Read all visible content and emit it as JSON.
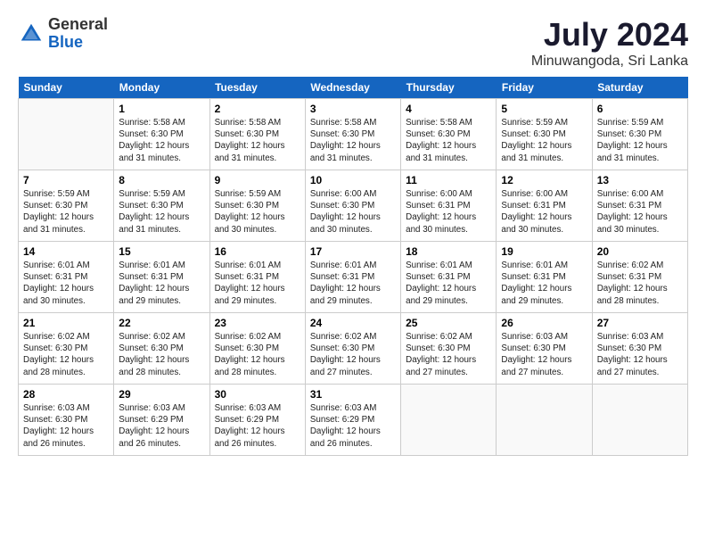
{
  "header": {
    "logo": {
      "general": "General",
      "blue": "Blue"
    },
    "title": "July 2024",
    "location": "Minuwangoda, Sri Lanka"
  },
  "calendar": {
    "days_of_week": [
      "Sunday",
      "Monday",
      "Tuesday",
      "Wednesday",
      "Thursday",
      "Friday",
      "Saturday"
    ],
    "weeks": [
      [
        {
          "day": "",
          "info": ""
        },
        {
          "day": "1",
          "info": "Sunrise: 5:58 AM\nSunset: 6:30 PM\nDaylight: 12 hours\nand 31 minutes."
        },
        {
          "day": "2",
          "info": "Sunrise: 5:58 AM\nSunset: 6:30 PM\nDaylight: 12 hours\nand 31 minutes."
        },
        {
          "day": "3",
          "info": "Sunrise: 5:58 AM\nSunset: 6:30 PM\nDaylight: 12 hours\nand 31 minutes."
        },
        {
          "day": "4",
          "info": "Sunrise: 5:58 AM\nSunset: 6:30 PM\nDaylight: 12 hours\nand 31 minutes."
        },
        {
          "day": "5",
          "info": "Sunrise: 5:59 AM\nSunset: 6:30 PM\nDaylight: 12 hours\nand 31 minutes."
        },
        {
          "day": "6",
          "info": "Sunrise: 5:59 AM\nSunset: 6:30 PM\nDaylight: 12 hours\nand 31 minutes."
        }
      ],
      [
        {
          "day": "7",
          "info": "Sunrise: 5:59 AM\nSunset: 6:30 PM\nDaylight: 12 hours\nand 31 minutes."
        },
        {
          "day": "8",
          "info": "Sunrise: 5:59 AM\nSunset: 6:30 PM\nDaylight: 12 hours\nand 31 minutes."
        },
        {
          "day": "9",
          "info": "Sunrise: 5:59 AM\nSunset: 6:30 PM\nDaylight: 12 hours\nand 30 minutes."
        },
        {
          "day": "10",
          "info": "Sunrise: 6:00 AM\nSunset: 6:30 PM\nDaylight: 12 hours\nand 30 minutes."
        },
        {
          "day": "11",
          "info": "Sunrise: 6:00 AM\nSunset: 6:31 PM\nDaylight: 12 hours\nand 30 minutes."
        },
        {
          "day": "12",
          "info": "Sunrise: 6:00 AM\nSunset: 6:31 PM\nDaylight: 12 hours\nand 30 minutes."
        },
        {
          "day": "13",
          "info": "Sunrise: 6:00 AM\nSunset: 6:31 PM\nDaylight: 12 hours\nand 30 minutes."
        }
      ],
      [
        {
          "day": "14",
          "info": "Sunrise: 6:01 AM\nSunset: 6:31 PM\nDaylight: 12 hours\nand 30 minutes."
        },
        {
          "day": "15",
          "info": "Sunrise: 6:01 AM\nSunset: 6:31 PM\nDaylight: 12 hours\nand 29 minutes."
        },
        {
          "day": "16",
          "info": "Sunrise: 6:01 AM\nSunset: 6:31 PM\nDaylight: 12 hours\nand 29 minutes."
        },
        {
          "day": "17",
          "info": "Sunrise: 6:01 AM\nSunset: 6:31 PM\nDaylight: 12 hours\nand 29 minutes."
        },
        {
          "day": "18",
          "info": "Sunrise: 6:01 AM\nSunset: 6:31 PM\nDaylight: 12 hours\nand 29 minutes."
        },
        {
          "day": "19",
          "info": "Sunrise: 6:01 AM\nSunset: 6:31 PM\nDaylight: 12 hours\nand 29 minutes."
        },
        {
          "day": "20",
          "info": "Sunrise: 6:02 AM\nSunset: 6:31 PM\nDaylight: 12 hours\nand 28 minutes."
        }
      ],
      [
        {
          "day": "21",
          "info": "Sunrise: 6:02 AM\nSunset: 6:30 PM\nDaylight: 12 hours\nand 28 minutes."
        },
        {
          "day": "22",
          "info": "Sunrise: 6:02 AM\nSunset: 6:30 PM\nDaylight: 12 hours\nand 28 minutes."
        },
        {
          "day": "23",
          "info": "Sunrise: 6:02 AM\nSunset: 6:30 PM\nDaylight: 12 hours\nand 28 minutes."
        },
        {
          "day": "24",
          "info": "Sunrise: 6:02 AM\nSunset: 6:30 PM\nDaylight: 12 hours\nand 27 minutes."
        },
        {
          "day": "25",
          "info": "Sunrise: 6:02 AM\nSunset: 6:30 PM\nDaylight: 12 hours\nand 27 minutes."
        },
        {
          "day": "26",
          "info": "Sunrise: 6:03 AM\nSunset: 6:30 PM\nDaylight: 12 hours\nand 27 minutes."
        },
        {
          "day": "27",
          "info": "Sunrise: 6:03 AM\nSunset: 6:30 PM\nDaylight: 12 hours\nand 27 minutes."
        }
      ],
      [
        {
          "day": "28",
          "info": "Sunrise: 6:03 AM\nSunset: 6:30 PM\nDaylight: 12 hours\nand 26 minutes."
        },
        {
          "day": "29",
          "info": "Sunrise: 6:03 AM\nSunset: 6:29 PM\nDaylight: 12 hours\nand 26 minutes."
        },
        {
          "day": "30",
          "info": "Sunrise: 6:03 AM\nSunset: 6:29 PM\nDaylight: 12 hours\nand 26 minutes."
        },
        {
          "day": "31",
          "info": "Sunrise: 6:03 AM\nSunset: 6:29 PM\nDaylight: 12 hours\nand 26 minutes."
        },
        {
          "day": "",
          "info": ""
        },
        {
          "day": "",
          "info": ""
        },
        {
          "day": "",
          "info": ""
        }
      ]
    ]
  }
}
